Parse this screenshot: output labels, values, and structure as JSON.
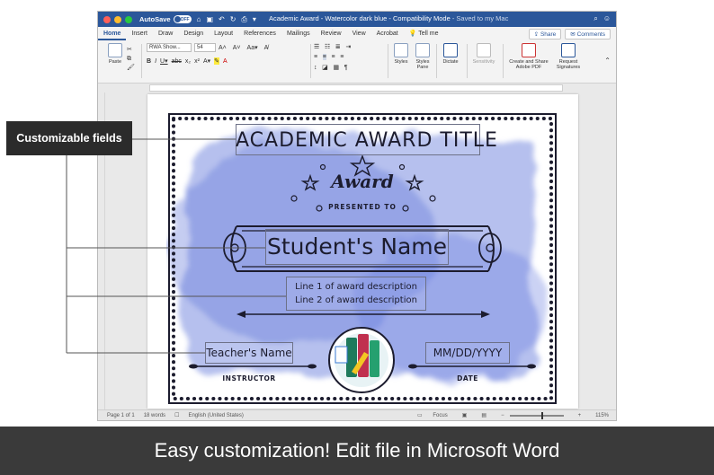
{
  "window": {
    "autosave_label": "AutoSave",
    "autosave_state": "OFF",
    "doc_title": "Academic Award - Watercolor dark blue  -  Compatibility Mode",
    "saved_status": "  -  Saved to my Mac",
    "accent": "#2b579a"
  },
  "tabs": [
    "Home",
    "Insert",
    "Draw",
    "Design",
    "Layout",
    "References",
    "Mailings",
    "Review",
    "View",
    "Acrobat"
  ],
  "tell_me": "Tell me",
  "share_label": "Share",
  "comments_label": "Comments",
  "ribbon": {
    "paste_label": "Paste",
    "font_name": "RWA Show...",
    "font_size": "54",
    "styles_label": "Styles",
    "styles_pane_label": "Styles Pane",
    "dictate_label": "Dictate",
    "sensitivity_label": "Sensitivity",
    "create_share_label": "Create and Share Adobe PDF",
    "request_sig_label": "Request Signatures"
  },
  "status": {
    "page": "Page 1 of 1",
    "words": "18 words",
    "language": "English (United States)",
    "focus": "Focus",
    "zoom": "115%"
  },
  "certificate": {
    "title": "ACADEMIC AWARD TITLE",
    "award": "Award",
    "presented_to": "PRESENTED TO",
    "student_name": "Student's Name",
    "desc_line1": "Line 1 of award description",
    "desc_line2": "Line 2 of award description",
    "teacher_name": "Teacher's Name",
    "instructor_label": "INSTRUCTOR",
    "date_field": "MM/DD/YYYY",
    "date_label": "DATE",
    "wash_color": "#5b6fd6"
  },
  "callout": {
    "label": "Customizable fields"
  },
  "banner": {
    "text": "Easy customization! Edit file in Microsoft Word"
  }
}
